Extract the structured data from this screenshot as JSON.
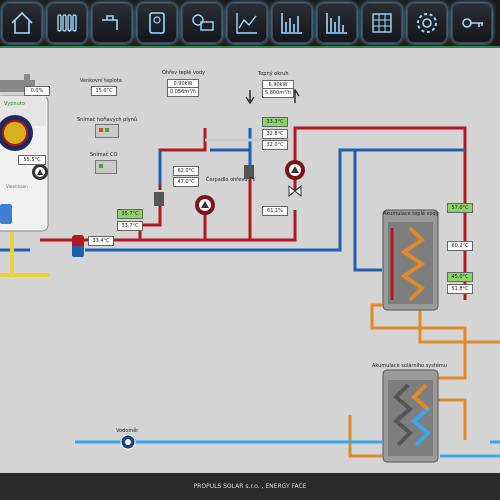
{
  "nav": {
    "items": [
      {
        "name": "home"
      },
      {
        "name": "radiator"
      },
      {
        "name": "hot-water-tap"
      },
      {
        "name": "boiler"
      },
      {
        "name": "solar-collector"
      },
      {
        "name": "graph"
      },
      {
        "name": "bar-chart-daily"
      },
      {
        "name": "bar-chart-monthly"
      },
      {
        "name": "table"
      },
      {
        "name": "settings"
      },
      {
        "name": "key"
      }
    ]
  },
  "boiler": {
    "status": "Vypnuto",
    "percent": "0.0%",
    "temperature": "55.5°C",
    "brand": "Viessmann"
  },
  "outdoor": {
    "label": "Venkovní teplota",
    "value": "15.0°C"
  },
  "flue_sensor": {
    "label": "Snímač hořlavých plynů"
  },
  "co_sensor": {
    "label": "Snímač CO"
  },
  "hot_water_heat": {
    "label": "Ohřev teplé vody",
    "power": "0.90kW",
    "flow": "0.056m³/h"
  },
  "heating_circuit": {
    "label": "Topný okruh",
    "power": "6.90kW",
    "flow": "5.800m³/h",
    "t1": "33.3°C",
    "t2": "32.8°C",
    "t3": "32.0°C",
    "valve": "61.1%"
  },
  "pump_tv": {
    "label": "Čerpadlo ohřevu TV"
  },
  "hw_temps": {
    "t1": "62.0°C",
    "t2": "47.0°C"
  },
  "left_temps": {
    "t1": "35.7°C",
    "t2": "33.7°C",
    "t3": "33.4°C"
  },
  "hot_water_tank": {
    "label": "Akumulace teplé vody",
    "t1": "57.0°C",
    "t2": "60.2°C",
    "t3": "45.0°C",
    "t4": "51.8°C"
  },
  "solar_tank": {
    "label": "Akumulace solárního systému"
  },
  "water_meter": {
    "label": "Vodoměr"
  },
  "footer": {
    "text": "PROPULS SOLAR s.r.o. , ENERGY FACE"
  },
  "colors": {
    "hot": "#b0191e",
    "cold": "#1e5fb0",
    "solar": "#e08a2a",
    "accent": "#2f8a2f",
    "water": "#3aa6e6"
  }
}
